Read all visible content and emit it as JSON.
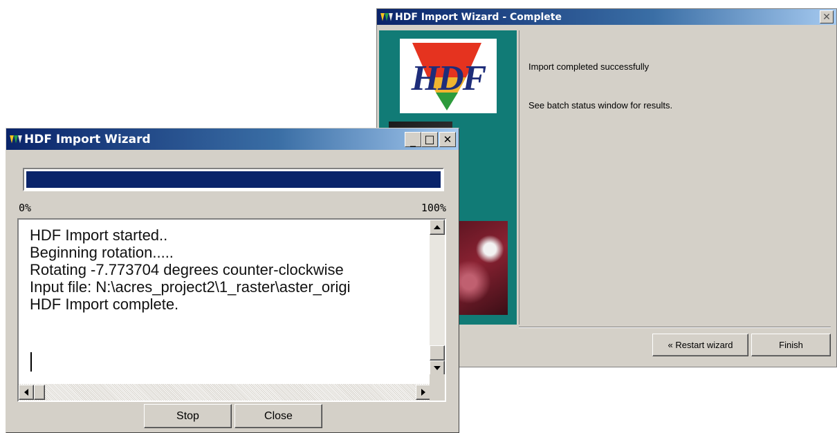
{
  "complete_window": {
    "title": "HDF Import Wizard - Complete",
    "logo_text": "HDF",
    "message_1": "Import completed successfully",
    "message_2": "See batch status window for results.",
    "restart_label": "« Restart wizard",
    "finish_label": "Finish",
    "close_glyph": "✕"
  },
  "import_window": {
    "title": "HDF Import Wizard",
    "minimize_glyph": "_",
    "maximize_glyph": "□",
    "close_glyph": "✕",
    "progress_fraction": 1.0,
    "progress_min_label": "0%",
    "progress_max_label": "100%",
    "log_lines": [
      "HDF Import started..",
      "Beginning rotation.....",
      "Rotating  -7.773704 degrees counter-clockwise",
      "Input  file: N:\\acres_project2\\1_raster\\aster_origi",
      "HDF Import complete."
    ],
    "stop_label": "Stop",
    "close_label": "Close"
  },
  "colors": {
    "title_active": "#0a246a",
    "panel_teal": "#117b76",
    "window_face": "#d4d0c8"
  }
}
